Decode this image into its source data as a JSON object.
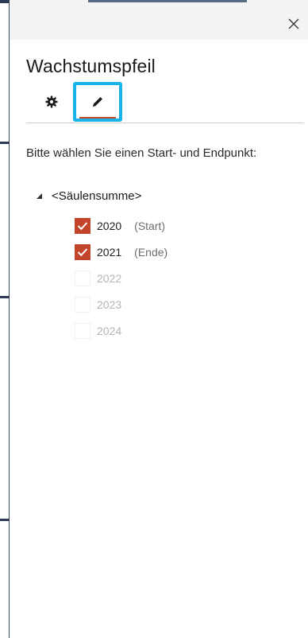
{
  "panel": {
    "title": "Wachstumspfeil",
    "instruction": "Bitte wählen Sie einen Start- und Endpunkt:"
  },
  "titlebar": {
    "close_icon": "close-icon"
  },
  "tabs": [
    {
      "icon": "gear-icon",
      "selected": false
    },
    {
      "icon": "pencil-icon",
      "selected": true
    }
  ],
  "tree": {
    "root_label": "<Säulensumme>",
    "expanded": true,
    "items": [
      {
        "year": "2020",
        "note": "(Start)",
        "checked": true,
        "enabled": true
      },
      {
        "year": "2021",
        "note": "(Ende)",
        "checked": true,
        "enabled": true
      },
      {
        "year": "2022",
        "note": "",
        "checked": false,
        "enabled": false
      },
      {
        "year": "2023",
        "note": "",
        "checked": false,
        "enabled": false
      },
      {
        "year": "2024",
        "note": "",
        "checked": false,
        "enabled": false
      }
    ]
  },
  "colors": {
    "accent_checkbox": "#c2452b",
    "tab_highlight": "#18b3e8",
    "tab_underline": "#c8462a"
  }
}
